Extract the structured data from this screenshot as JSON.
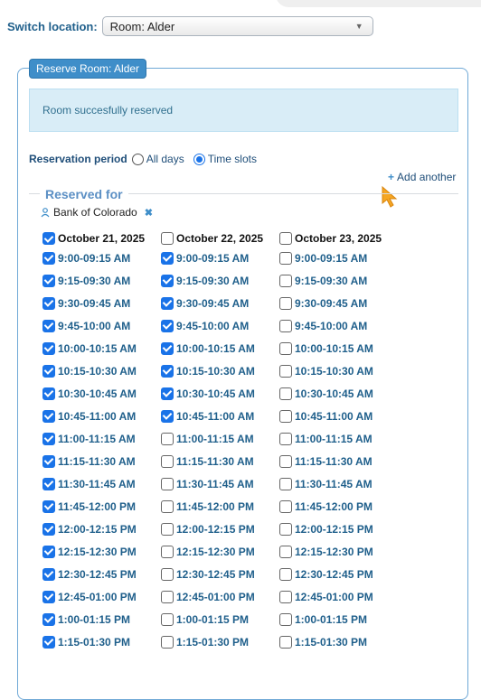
{
  "switch_location": {
    "label": "Switch location:",
    "selected": "Room: Alder"
  },
  "panel": {
    "title": "Reserve Room: Alder"
  },
  "alert": {
    "message": "Room succesfully reserved"
  },
  "period": {
    "label": "Reservation period",
    "options": [
      "All days",
      "Time slots"
    ],
    "selected": "Time slots"
  },
  "add_another": "Add another",
  "reserved_for": {
    "title": "Reserved for",
    "name": "Bank of Colorado"
  },
  "slots": [
    "9:00-09:15 AM",
    "9:15-09:30 AM",
    "9:30-09:45 AM",
    "9:45-10:00 AM",
    "10:00-10:15 AM",
    "10:15-10:30 AM",
    "10:30-10:45 AM",
    "10:45-11:00 AM",
    "11:00-11:15 AM",
    "11:15-11:30 AM",
    "11:30-11:45 AM",
    "11:45-12:00 PM",
    "12:00-12:15 PM",
    "12:15-12:30 PM",
    "12:30-12:45 PM",
    "12:45-01:00 PM",
    "1:00-01:15 PM",
    "1:15-01:30 PM"
  ],
  "days": [
    {
      "date": "October 21, 2025",
      "date_checked": true,
      "checked": [
        true,
        true,
        true,
        true,
        true,
        true,
        true,
        true,
        true,
        true,
        true,
        true,
        true,
        true,
        true,
        true,
        true,
        true
      ]
    },
    {
      "date": "October 22, 2025",
      "date_checked": false,
      "checked": [
        true,
        true,
        true,
        true,
        true,
        true,
        true,
        true,
        false,
        false,
        false,
        false,
        false,
        false,
        false,
        false,
        false,
        false
      ]
    },
    {
      "date": "October 23, 2025",
      "date_checked": false,
      "checked": [
        false,
        false,
        false,
        false,
        false,
        false,
        false,
        false,
        false,
        false,
        false,
        false,
        false,
        false,
        false,
        false,
        false,
        false
      ]
    }
  ]
}
